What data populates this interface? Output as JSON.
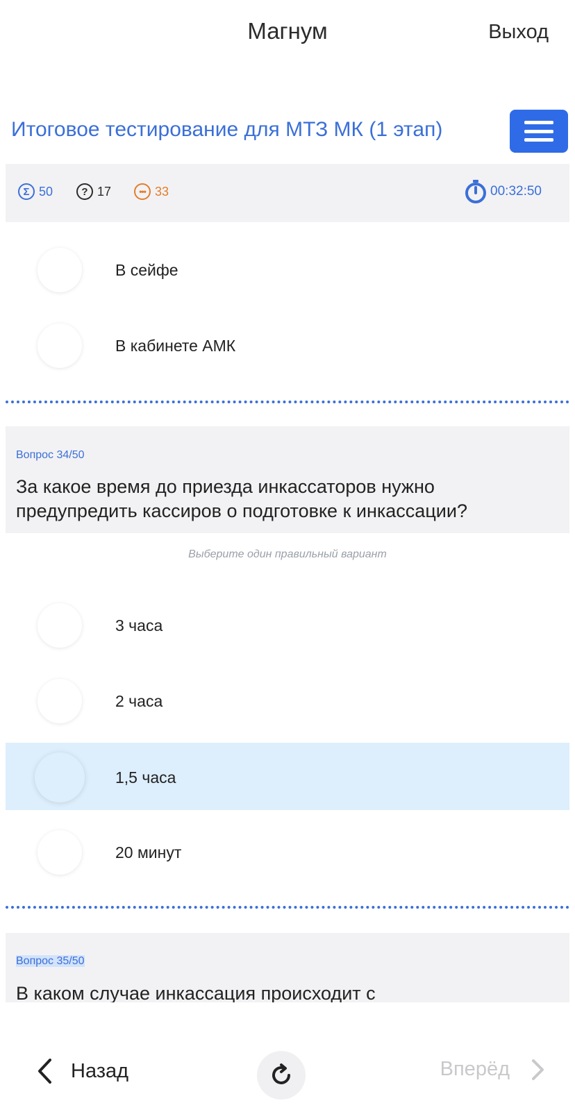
{
  "header": {
    "app_title": "Магнум",
    "logout_label": "Выход"
  },
  "test": {
    "title": "Итоговое тестирование для МТЗ МК (1 этап)"
  },
  "stats": {
    "total": "50",
    "answered": "17",
    "remaining": "33",
    "timer": "00:32:50",
    "colors": {
      "total": "#3b6fd8",
      "answered": "#2b2b2b",
      "remaining": "#e27d2a",
      "timer": "#3b6fd8"
    },
    "icons": {
      "total": "sigma-icon",
      "answered": "question-circle-icon",
      "remaining": "ellipsis-circle-icon",
      "timer": "stopwatch-icon"
    }
  },
  "previous_question": {
    "options": [
      {
        "label": "В сейфе",
        "selected": false
      },
      {
        "label": "В кабинете АМК",
        "selected": false
      }
    ]
  },
  "question_34": {
    "number": "Вопрос 34/50",
    "text": "За какое время до приезда инкассаторов нужно предупредить кассиров о подготовке к инкассации?",
    "hint": "Выберите один правильный вариант",
    "options": [
      {
        "label": "3 часа",
        "selected": false
      },
      {
        "label": "2 часа",
        "selected": false
      },
      {
        "label": "1,5 часа",
        "selected": true
      },
      {
        "label": "20 минут",
        "selected": false
      }
    ]
  },
  "question_35": {
    "number": "Вопрос 35/50",
    "text": "В каком случае инкассация происходит с"
  },
  "bottom_nav": {
    "back_label": "Назад",
    "forward_label": "Вперёд"
  },
  "theme": {
    "accent": "#2f6be6",
    "selected_bg": "#ddeefc",
    "card_bg": "#f2f2f4"
  }
}
